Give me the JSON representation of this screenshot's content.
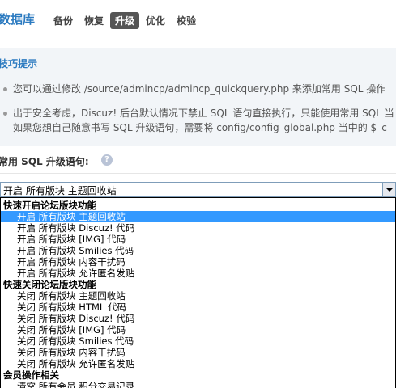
{
  "header": {
    "title": "数据库",
    "nav": [
      {
        "label": "备份",
        "active": false
      },
      {
        "label": "恢复",
        "active": false
      },
      {
        "label": "升级",
        "active": true
      },
      {
        "label": "优化",
        "active": false
      },
      {
        "label": "校验",
        "active": false
      }
    ]
  },
  "tips": {
    "title": "技巧提示",
    "line1": "您可以通过修改 /source/admincp/admincp_quickquery.php 来添加常用 SQL 操作",
    "line2a": "出于安全考虑，Discuz! 后台默认情况下禁止 SQL 语句直接执行，只能使用常用 SQL 当",
    "line2b": "如果您想自己随意书写 SQL 升级语句，需要将 config/config_global.php 当中的 $_c"
  },
  "form": {
    "label": "常用 SQL 升级语句:",
    "help_icon": "?",
    "selected_value": "开启 所有版块 主题回收站"
  },
  "dropdown": {
    "groups": [
      {
        "label": "快速开启论坛版块功能",
        "options": [
          {
            "label": "开启 所有版块 主题回收站",
            "selected": true
          },
          {
            "label": "开启 所有版块 Discuz! 代码",
            "selected": false
          },
          {
            "label": "开启 所有版块 [IMG] 代码",
            "selected": false
          },
          {
            "label": "开启 所有版块 Smilies 代码",
            "selected": false
          },
          {
            "label": "开启 所有版块 内容干扰码",
            "selected": false
          },
          {
            "label": "开启 所有版块 允许匿名发贴",
            "selected": false
          }
        ]
      },
      {
        "label": "快速关闭论坛版块功能",
        "options": [
          {
            "label": "关闭 所有版块 主题回收站",
            "selected": false
          },
          {
            "label": "关闭 所有版块 HTML 代码",
            "selected": false
          },
          {
            "label": "关闭 所有版块 Discuz! 代码",
            "selected": false
          },
          {
            "label": "关闭 所有版块 [IMG] 代码",
            "selected": false
          },
          {
            "label": "关闭 所有版块 Smilies 代码",
            "selected": false
          },
          {
            "label": "关闭 所有版块 内容干扰码",
            "selected": false
          },
          {
            "label": "关闭 所有版块 允许匿名发贴",
            "selected": false
          }
        ]
      },
      {
        "label": "会员操作相关",
        "options": [
          {
            "label": "清空 所有会员 积分交易记录",
            "selected": false
          }
        ]
      }
    ]
  },
  "colors": {
    "accent": "#2b7ac0",
    "selection": "#3399ff"
  }
}
